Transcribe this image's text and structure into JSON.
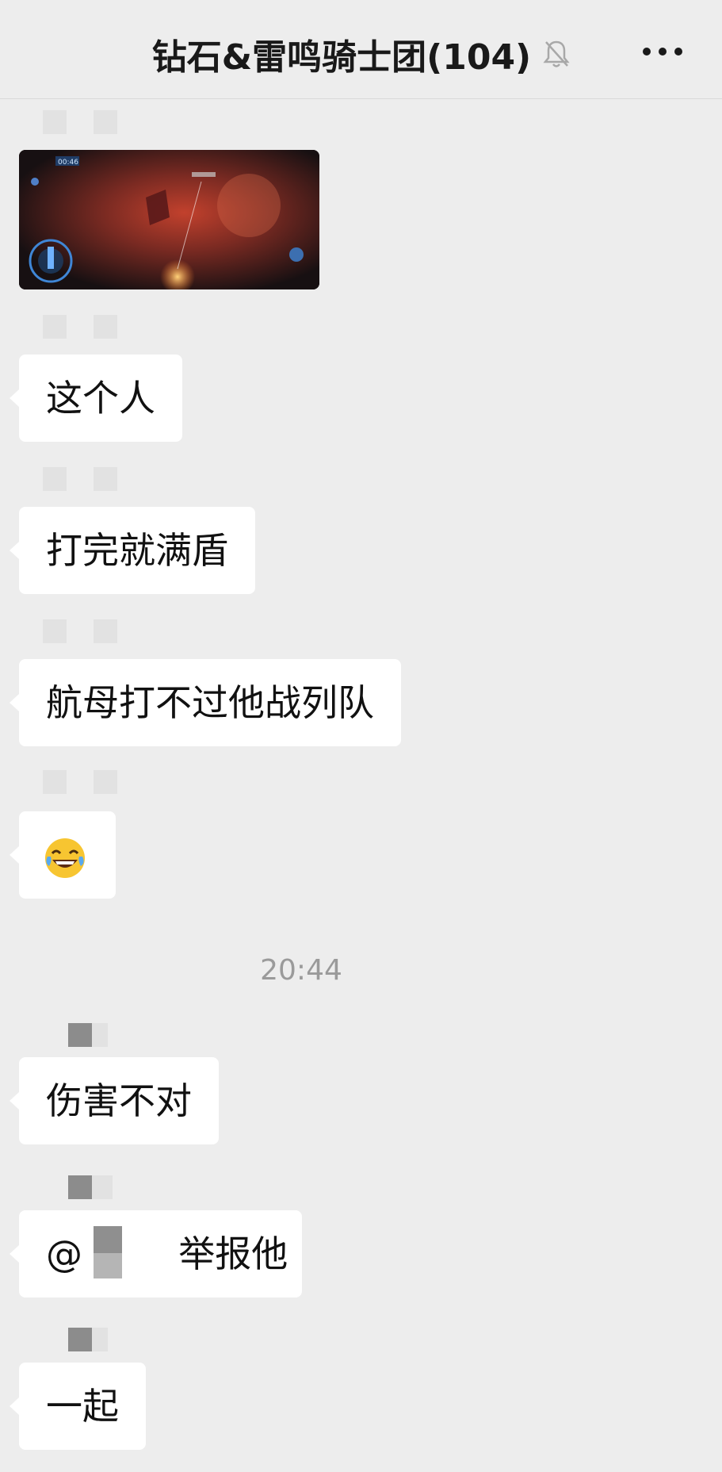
{
  "header": {
    "title": "钻石&雷鸣骑士团(104)",
    "icons": [
      "mute-bell-icon",
      "more-icon"
    ]
  },
  "messages": [
    {
      "type": "image",
      "image": {
        "label": "00:46"
      }
    },
    {
      "type": "text",
      "text": "这个人"
    },
    {
      "type": "text",
      "text": "打完就满盾"
    },
    {
      "type": "text",
      "text": "航母打不过他战列队"
    },
    {
      "type": "emoji",
      "emoji": "😂",
      "icon": "laughing-tears-emoji-icon"
    },
    {
      "type": "text",
      "text": "伤害不对"
    },
    {
      "type": "mention",
      "prefix": "@",
      "text": "举报他"
    },
    {
      "type": "text",
      "text": "一起"
    }
  ],
  "time_divider": "20:44",
  "colors": {
    "background": "#ededed",
    "bubble": "#ffffff",
    "text": "#111111",
    "time": "#9a9a9a"
  }
}
